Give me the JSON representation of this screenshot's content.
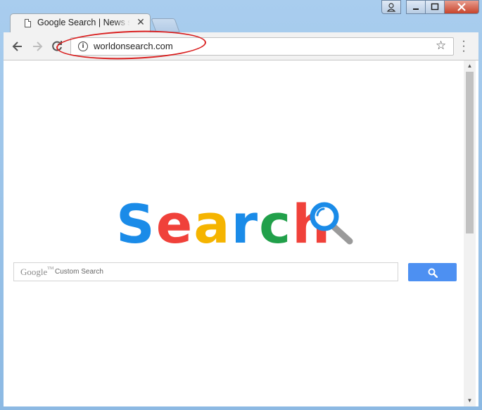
{
  "window": {
    "tab_title": "Google Search | News search",
    "controls": {
      "user": "user-icon",
      "minimize": "minimize-icon",
      "maximize": "maximize-icon",
      "close": "close-icon"
    }
  },
  "toolbar": {
    "back": "arrow-left-icon",
    "forward": "arrow-right-icon",
    "reload": "reload-icon",
    "url": "worldonsearch.com",
    "info": "info-icon",
    "bookmark": "star-icon",
    "menu": "menu-dots-icon"
  },
  "page": {
    "logo_letters": [
      {
        "char": "S",
        "color": "#1a8be8"
      },
      {
        "char": "e",
        "color": "#f0413a"
      },
      {
        "char": "a",
        "color": "#f5b400"
      },
      {
        "char": "r",
        "color": "#1a8be8"
      },
      {
        "char": "c",
        "color": "#21a04a"
      },
      {
        "char": "h",
        "color": "#f0413a"
      }
    ],
    "logo_icon": "magnifier-icon",
    "search_brand": "Google",
    "search_brand_tm": "TM",
    "search_placeholder": "Custom Search",
    "search_button_icon": "search-icon",
    "search_button_color": "#4d90f2"
  },
  "annotation": {
    "color": "#d91f1f"
  }
}
